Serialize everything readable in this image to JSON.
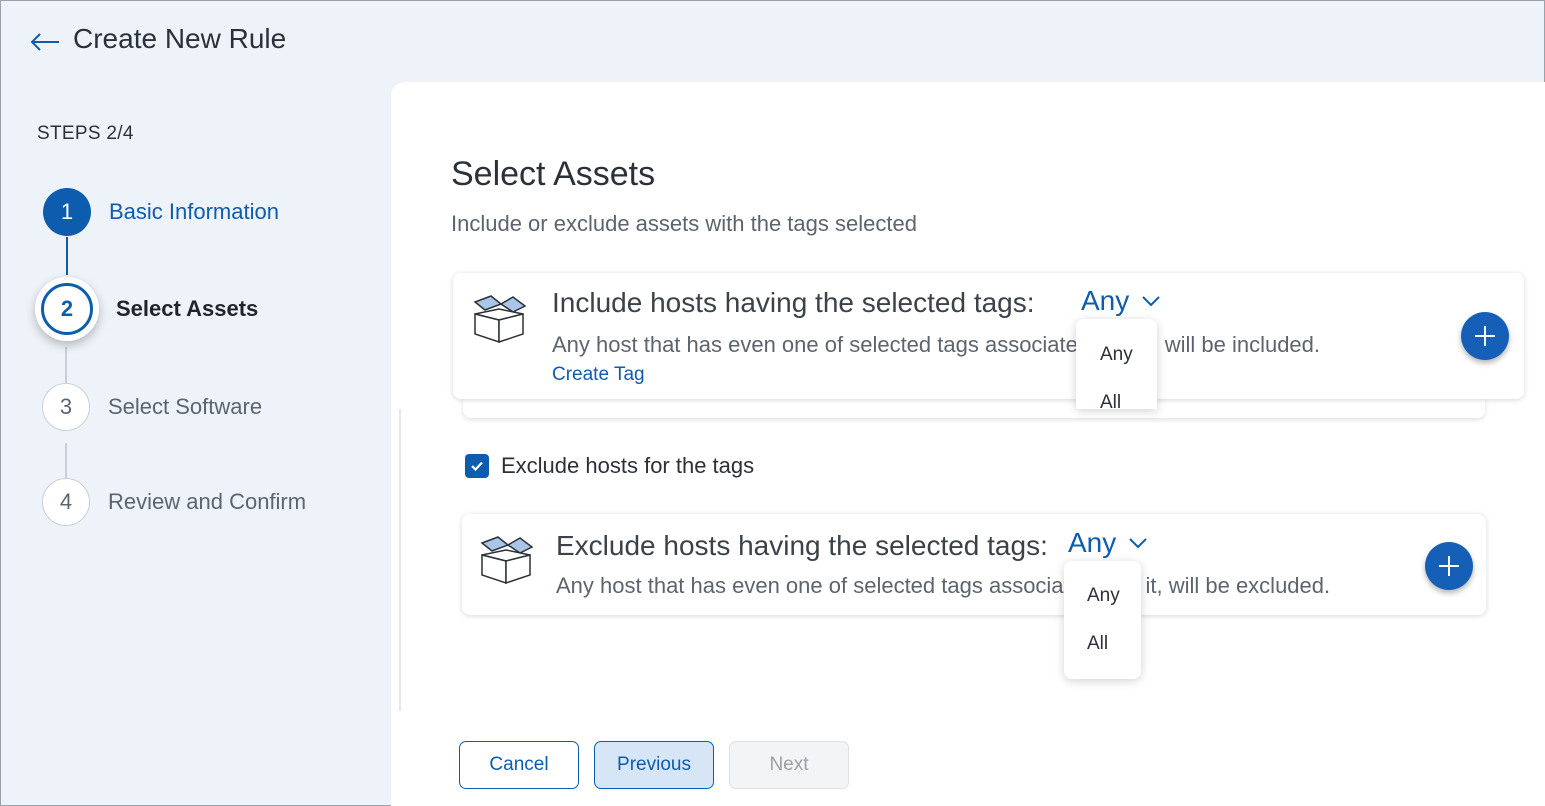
{
  "header": {
    "title": "Create New Rule"
  },
  "steps": {
    "label": "STEPS 2/4",
    "items": [
      {
        "number": "1",
        "label": "Basic Information",
        "state": "done"
      },
      {
        "number": "2",
        "label": "Select Assets",
        "state": "active"
      },
      {
        "number": "3",
        "label": "Select Software",
        "state": "pending"
      },
      {
        "number": "4",
        "label": "Review and Confirm",
        "state": "pending"
      }
    ]
  },
  "main": {
    "title": "Select Assets",
    "subtitle": "Include or exclude assets with the tags selected",
    "include_card": {
      "title": "Include hosts having the selected tags:",
      "match_value": "Any",
      "description": "Any host that has even one of selected tags associated with it, will be included.",
      "create_tag_label": "Create Tag",
      "dropdown_options": [
        "Any",
        "All"
      ]
    },
    "exclude_checkbox": {
      "label": "Exclude hosts for the tags",
      "checked": true
    },
    "exclude_card": {
      "title": "Exclude hosts having the selected tags:",
      "match_value": "Any",
      "description": "Any host that has even one of selected tags associated with it, will be excluded.",
      "dropdown_options": [
        "Any",
        "All"
      ]
    }
  },
  "footer": {
    "cancel_label": "Cancel",
    "previous_label": "Previous",
    "next_label": "Next"
  },
  "colors": {
    "accent": "#0e5cad",
    "background": "#eef3f9",
    "panel": "#ffffff"
  }
}
